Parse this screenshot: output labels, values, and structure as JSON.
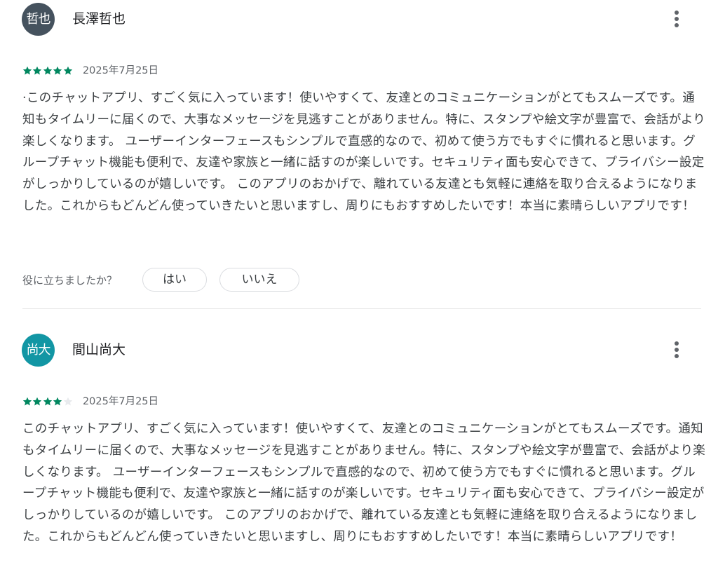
{
  "colors": {
    "star_filled": "#01875f",
    "star_empty": "#e8eaed",
    "text_primary": "#202124",
    "text_secondary": "#5f6368",
    "divider": "#e3e3e3"
  },
  "reviews": [
    {
      "avatar_text": "哲也",
      "avatar_color": "#45525e",
      "author": "長澤哲也",
      "rating": 5,
      "date": "2025年7月25日",
      "more_icon": "more-vert-icon",
      "body": "·このチャットアプリ、すごく気に入っています！使いやすくて、友達とのコミュニケーションがとてもスムーズです。通知もタイムリーに届くので、大事なメッセージを見逃すことがありません。特に、スタンプや絵文字が豊富で、会話がより楽しくなります。 ユーザーインターフェースもシンプルで直感的なので、初めて使う方でもすぐに慣れると思います。グループチャット機能も便利で、友達や家族と一緒に話すのが楽しいです。セキュリティ面も安心できて、プライバシー設定がしっかりしているのが嬉しいです。 このアプリのおかげで、離れている友達とも気軽に連絡を取り合えるようになりました。これからもどんどん使っていきたいと思いますし、周りにもおすすめしたいです！本当に素晴らしいアプリです！",
      "helpful_question": "役に立ちましたか？",
      "helpful_yes": "はい",
      "helpful_no": "いいえ"
    },
    {
      "avatar_text": "尚大",
      "avatar_color": "#1296a4",
      "author": "間山尚大",
      "rating": 4,
      "date": "2025年7月25日",
      "more_icon": "more-vert-icon",
      "body": "このチャットアプリ、すごく気に入っています！使いやすくて、友達とのコミュニケーションがとてもスムーズです。通知もタイムリーに届くので、大事なメッセージを見逃すことがありません。特に、スタンプや絵文字が豊富で、会話がより楽しくなります。 ユーザーインターフェースもシンプルで直感的なので、初めて使う方でもすぐに慣れると思います。グループチャット機能も便利で、友達や家族と一緒に話すのが楽しいです。セキュリティ面も安心できて、プライバシー設定がしっかりしているのが嬉しいです。 このアプリのおかげで、離れている友達とも気軽に連絡を取り合えるようになりました。これからもどんどん使っていきたいと思いますし、周りにもおすすめしたいです！本当に素晴らしいアプリです！"
    }
  ]
}
